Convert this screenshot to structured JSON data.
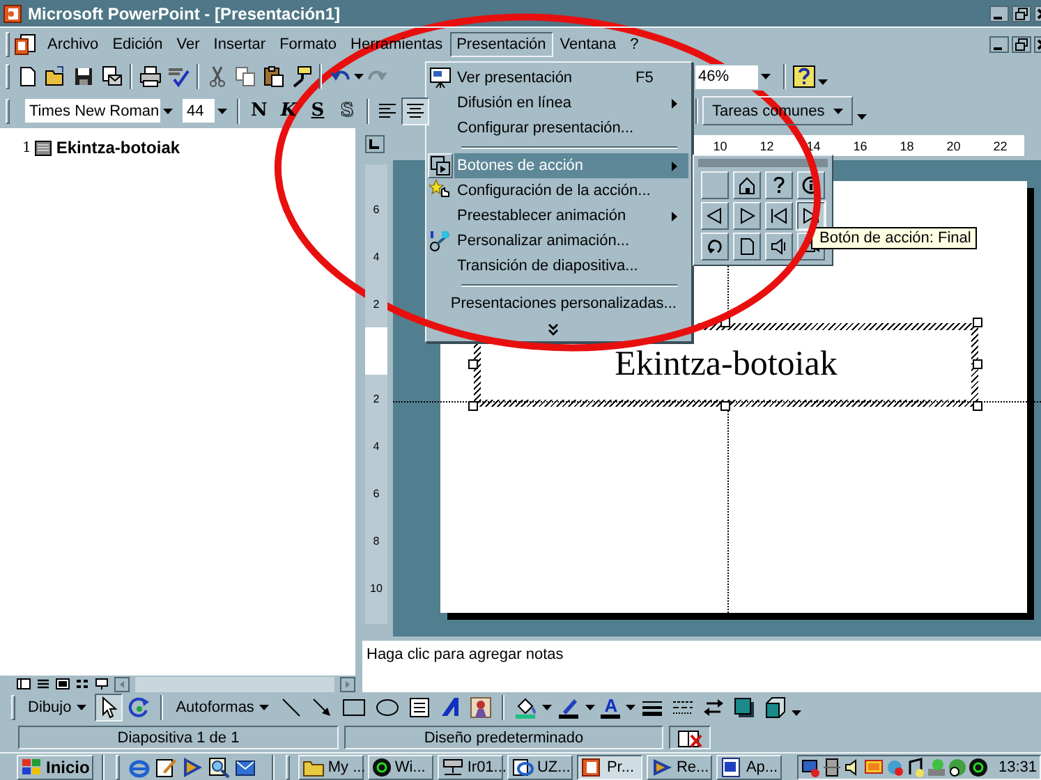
{
  "window": {
    "title": "Microsoft PowerPoint - [Presentación1]"
  },
  "menu_bar": [
    {
      "label": "Archivo",
      "selected": false
    },
    {
      "label": "Edición",
      "selected": false
    },
    {
      "label": "Ver",
      "selected": false
    },
    {
      "label": "Insertar",
      "selected": false
    },
    {
      "label": "Formato",
      "selected": false
    },
    {
      "label": "Herramientas",
      "selected": false
    },
    {
      "label": "Presentación",
      "selected": true
    },
    {
      "label": "Ventana",
      "selected": false
    },
    {
      "label": "?",
      "selected": false
    }
  ],
  "standard_toolbar": {
    "zoom": "46%"
  },
  "formatting_toolbar": {
    "font": "Times New Roman",
    "size": "44",
    "style_buttons": [
      "N",
      "K",
      "S",
      "S"
    ],
    "tasks_button": "Tareas comunes"
  },
  "outline": [
    {
      "number": "1",
      "title": "Ekintza-botoiak"
    }
  ],
  "horizontal_ruler": [
    "10",
    "12",
    "14",
    "16",
    "18",
    "20",
    "22"
  ],
  "vertical_ruler": {
    "above": [
      "6",
      "4",
      "2"
    ],
    "below": [
      "2",
      "4",
      "6",
      "8",
      "10"
    ]
  },
  "slide": {
    "title": "Ekintza-botoiak"
  },
  "notes": "Haga clic para agregar notas",
  "presentation_menu": [
    {
      "kind": "item",
      "label": "Ver presentación",
      "shortcut": "F5",
      "submenu": false,
      "selected": false
    },
    {
      "kind": "item",
      "label": "Difusión en línea",
      "submenu": true,
      "selected": false
    },
    {
      "kind": "item",
      "label": "Configurar presentación...",
      "submenu": false,
      "selected": false
    },
    {
      "kind": "separator"
    },
    {
      "kind": "item",
      "label": "Botones de acción",
      "submenu": true,
      "selected": true
    },
    {
      "kind": "item",
      "label": "Configuración de la acción...",
      "submenu": false,
      "selected": false
    },
    {
      "kind": "item",
      "label": "Preestablecer animación",
      "submenu": true,
      "selected": false
    },
    {
      "kind": "item",
      "label": "Personalizar animación...",
      "submenu": false,
      "selected": false
    },
    {
      "kind": "item",
      "label": "Transición de diapositiva...",
      "submenu": false,
      "selected": false
    },
    {
      "kind": "separator"
    },
    {
      "kind": "item",
      "label": "Presentaciones personalizadas...",
      "submenu": false,
      "selected": false
    },
    {
      "kind": "expand"
    }
  ],
  "action_buttons": [
    {
      "kind": "custom",
      "selected": false
    },
    {
      "kind": "home",
      "selected": false
    },
    {
      "kind": "help",
      "selected": false
    },
    {
      "kind": "information",
      "selected": false
    },
    {
      "kind": "back",
      "selected": false
    },
    {
      "kind": "next",
      "selected": false
    },
    {
      "kind": "beginning",
      "selected": false
    },
    {
      "kind": "end",
      "selected": true
    },
    {
      "kind": "return",
      "selected": false
    },
    {
      "kind": "document",
      "selected": false
    },
    {
      "kind": "sound",
      "selected": false
    },
    {
      "kind": "movie",
      "selected": false
    }
  ],
  "tooltip": "Botón de acción: Final",
  "drawing_toolbar": {
    "draw_menu": "Dibujo",
    "autoshapes_menu": "Autoformas",
    "font_color": "A"
  },
  "status_bar": [
    "Diapositiva 1 de 1",
    "Diseño predeterminado"
  ],
  "taskbar": {
    "start": "Inicio",
    "tasks": [
      {
        "kind": "folder",
        "label": "My ...",
        "selected": false
      },
      {
        "kind": "disc",
        "label": "Wi...",
        "selected": false
      },
      {
        "kind": "network",
        "label": "Ir01...",
        "selected": false
      },
      {
        "kind": "browser",
        "label": "UZ...",
        "selected": false
      },
      {
        "kind": "presentation",
        "label": "Pr...",
        "selected": true
      },
      {
        "kind": "player",
        "label": "Re...",
        "selected": false
      },
      {
        "kind": "document",
        "label": "Ap...",
        "selected": false
      }
    ],
    "clock": "13:31"
  },
  "annotation": {
    "kind": "ellipse"
  }
}
